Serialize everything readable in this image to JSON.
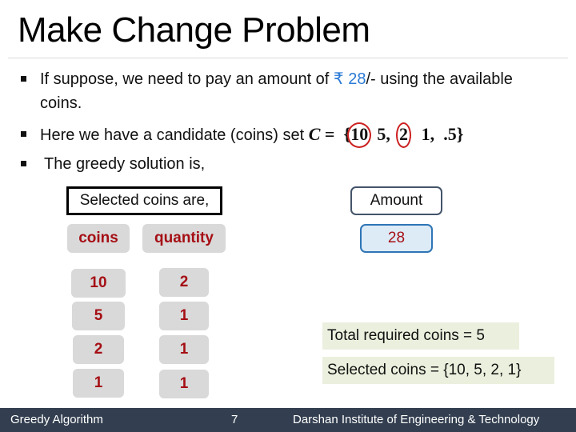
{
  "slide": {
    "title": "Make Change Problem",
    "bullets": [
      {
        "pre": "If suppose, we need to pay an amount of ",
        "highlight": "₹ 28",
        "post": "/- using the available",
        "continuation": "coins."
      },
      {
        "pre": "Here we have a candidate (coins) set ",
        "set_symbol": "C",
        "equals": " = ",
        "open_brace": "{",
        "elements": [
          "10",
          "5,",
          "2",
          "1,",
          ".5"
        ],
        "circled_elements": [
          "10",
          "2"
        ],
        "close_brace": "}"
      },
      {
        "text": "The greedy solution is,"
      }
    ],
    "colors": {
      "highlight": "#2a7ad6",
      "circle": "#cc2020",
      "chip_text": "#a50f15",
      "footer_bg": "#333f50"
    }
  },
  "selection": {
    "label": "Selected coins are,",
    "headers": {
      "coins": "coins",
      "quantity": "quantity"
    },
    "rows": [
      {
        "coin": "10",
        "quantity": "2"
      },
      {
        "coin": "5",
        "quantity": "1"
      },
      {
        "coin": "2",
        "quantity": "1"
      },
      {
        "coin": "1",
        "quantity": "1"
      }
    ]
  },
  "amount": {
    "label": "Amount",
    "value": "28"
  },
  "summary": {
    "total": "Total required coins = 5",
    "selected": "Selected coins = {10, 5, 2, 1}"
  },
  "footer": {
    "left": "Greedy Algorithm",
    "page": "7",
    "right": "Darshan Institute of Engineering & Technology"
  }
}
